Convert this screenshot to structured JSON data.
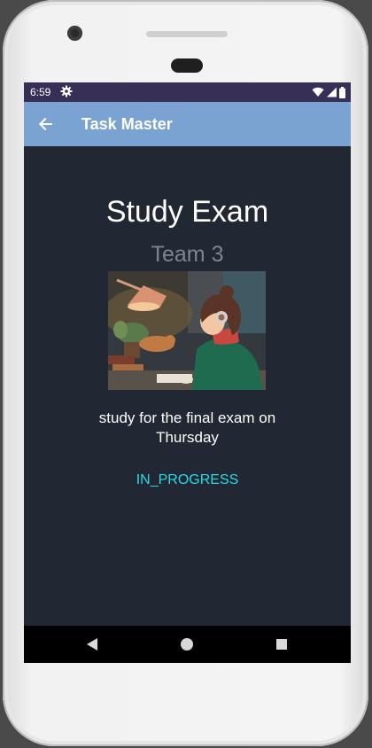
{
  "status_bar": {
    "time": "6:59",
    "icons": [
      "gear-icon",
      "wifi-icon",
      "signal-icon",
      "battery-icon"
    ]
  },
  "app_bar": {
    "title": "Task Master",
    "back_icon": "arrow-left-icon",
    "color": "#7aa3d2"
  },
  "task": {
    "title": "Study Exam",
    "team": "Team 3",
    "description": "study for the final exam on Thursday",
    "status": "IN_PROGRESS",
    "status_color": "#2ad9e6"
  },
  "nav_bar": {
    "icons": [
      "back-triangle-icon",
      "home-circle-icon",
      "recents-square-icon"
    ]
  },
  "colors": {
    "background": "#212833",
    "status_bar": "#372f55"
  }
}
